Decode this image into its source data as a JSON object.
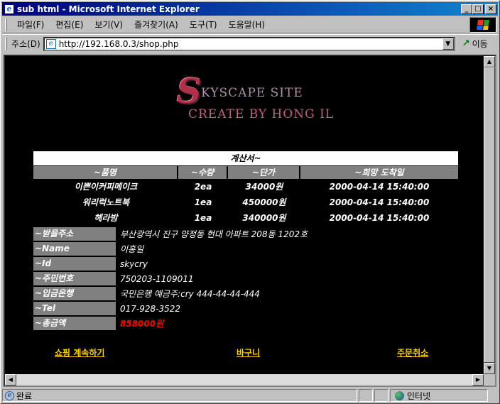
{
  "window": {
    "title": "sub html - Microsoft Internet Explorer",
    "minimize": "_",
    "maximize": "□",
    "close": "×"
  },
  "menu": [
    "파일(F)",
    "편집(E)",
    "보기(V)",
    "즐겨찾기(A)",
    "도구(T)",
    "도움말(H)"
  ],
  "address": {
    "label": "주소(D)",
    "url": "http://192.168.0.3/shop.php",
    "go_label": "이동"
  },
  "logo": {
    "letter": "S",
    "line1": "KYSCAPE SITE",
    "line2": "CREATE BY HONG IL"
  },
  "bill": {
    "title": "계산서~",
    "headers": [
      "~품명",
      "~수량",
      "~단가",
      "~희망 도착일"
    ],
    "rows": [
      {
        "name": "이쁜이커피메이크",
        "qty": "2ea",
        "price": "34000원",
        "date": "2000-04-14 15:40:00"
      },
      {
        "name": "워리럭노트북",
        "qty": "1ea",
        "price": "450000원",
        "date": "2000-04-14 15:40:00"
      },
      {
        "name": "헤라밤",
        "qty": "1ea",
        "price": "340000원",
        "date": "2000-04-14 15:40:00"
      }
    ]
  },
  "info": [
    {
      "label": "~받을주소",
      "value": "부산광역시 진구 양정동 현대 아파트 208동 1202호"
    },
    {
      "label": "~Name",
      "value": "이홍일"
    },
    {
      "label": "~Id",
      "value": "skycry"
    },
    {
      "label": "~주민번호",
      "value": "750203-1109011"
    },
    {
      "label": "~입금은행",
      "value": "국민은행 예금주:cry 444-44-44-444"
    },
    {
      "label": "~Tel",
      "value": "017-928-3522"
    },
    {
      "label": "~총금액",
      "value": "858000원"
    }
  ],
  "links": {
    "continue": "쇼핑 계속하기",
    "cart": "바구니",
    "cancel": "주문취소"
  },
  "status": {
    "text": "완료",
    "zone": "인터넷"
  },
  "colors": {
    "title_bar": "#000080",
    "link": "#ffd000",
    "total": "#ff0000",
    "label_bg": "#808080"
  }
}
